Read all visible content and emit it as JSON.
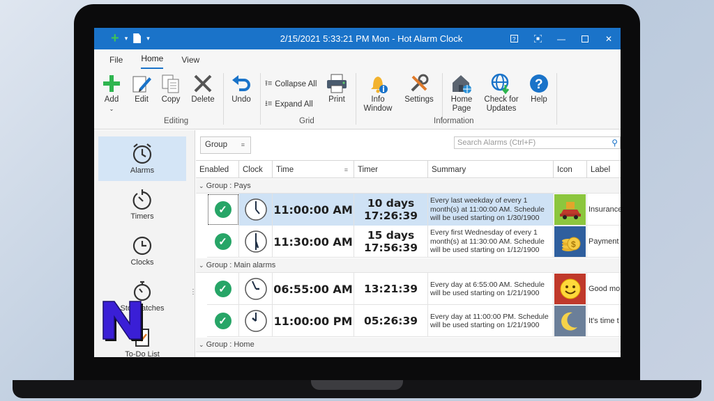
{
  "window": {
    "title": "2/15/2021 5:33:21 PM Mon - Hot Alarm Clock"
  },
  "ribbon_tabs": [
    "File",
    "Home",
    "View"
  ],
  "ribbon": {
    "editing": {
      "group_label": "Editing",
      "add": "Add",
      "edit": "Edit",
      "copy": "Copy",
      "delete": "Delete",
      "undo": "Undo"
    },
    "grid": {
      "group_label": "Grid",
      "collapse_all": "Collapse All",
      "expand_all": "Expand All",
      "print": "Print"
    },
    "information": {
      "group_label": "Information",
      "info_window_1": "Info",
      "info_window_2": "Window",
      "settings": "Settings",
      "home_page_1": "Home",
      "home_page_2": "Page",
      "check_updates_1": "Check for",
      "check_updates_2": "Updates",
      "help": "Help"
    }
  },
  "nav": {
    "alarms": "Alarms",
    "timers": "Timers",
    "clocks": "Clocks",
    "stopwatches": "Stopwatches",
    "todo": "To-Do List"
  },
  "toolbar": {
    "group_button": "Group",
    "search_placeholder": "Search Alarms (Ctrl+F)"
  },
  "grid": {
    "headers": {
      "enabled": "Enabled",
      "clock": "Clock",
      "time": "Time",
      "timer": "Timer",
      "summary": "Summary",
      "icon": "Icon",
      "label": "Label"
    },
    "groups": [
      {
        "title": "Group : Pays",
        "rows": [
          {
            "time": "11:00:00 AM",
            "timer_line1": "10 days",
            "timer_line2": "17:26:39",
            "summary": "Every last weekday of every 1 month(s) at 11:00:00 AM. Schedule will be used starting on 1/30/1900",
            "icon": "car-icon",
            "label": "Insurance"
          },
          {
            "time": "11:30:00 AM",
            "timer_line1": "15 days",
            "timer_line2": "17:56:39",
            "summary": "Every first Wednesday of every 1 month(s) at 11:30:00 AM. Schedule will be used starting on 1/12/1900",
            "icon": "coins-icon",
            "label": "Payment"
          }
        ]
      },
      {
        "title": "Group : Main alarms",
        "rows": [
          {
            "time": "06:55:00 AM",
            "timer": "13:21:39",
            "summary": "Every day at 6:55:00 AM. Schedule will be used starting on 1/21/1900",
            "icon": "smiley-icon",
            "label": "Good mo"
          },
          {
            "time": "11:00:00 PM",
            "timer": "05:26:39",
            "summary": "Every day at 11:00:00 PM. Schedule will be used starting on 1/21/1900",
            "icon": "moon-icon",
            "label": "It's time t"
          }
        ]
      },
      {
        "title": "Group : Home",
        "rows": []
      }
    ]
  },
  "colors": {
    "titlebar": "#1a73c9",
    "enabled_check": "#27a567",
    "selected_row": "#cfe2f5"
  }
}
